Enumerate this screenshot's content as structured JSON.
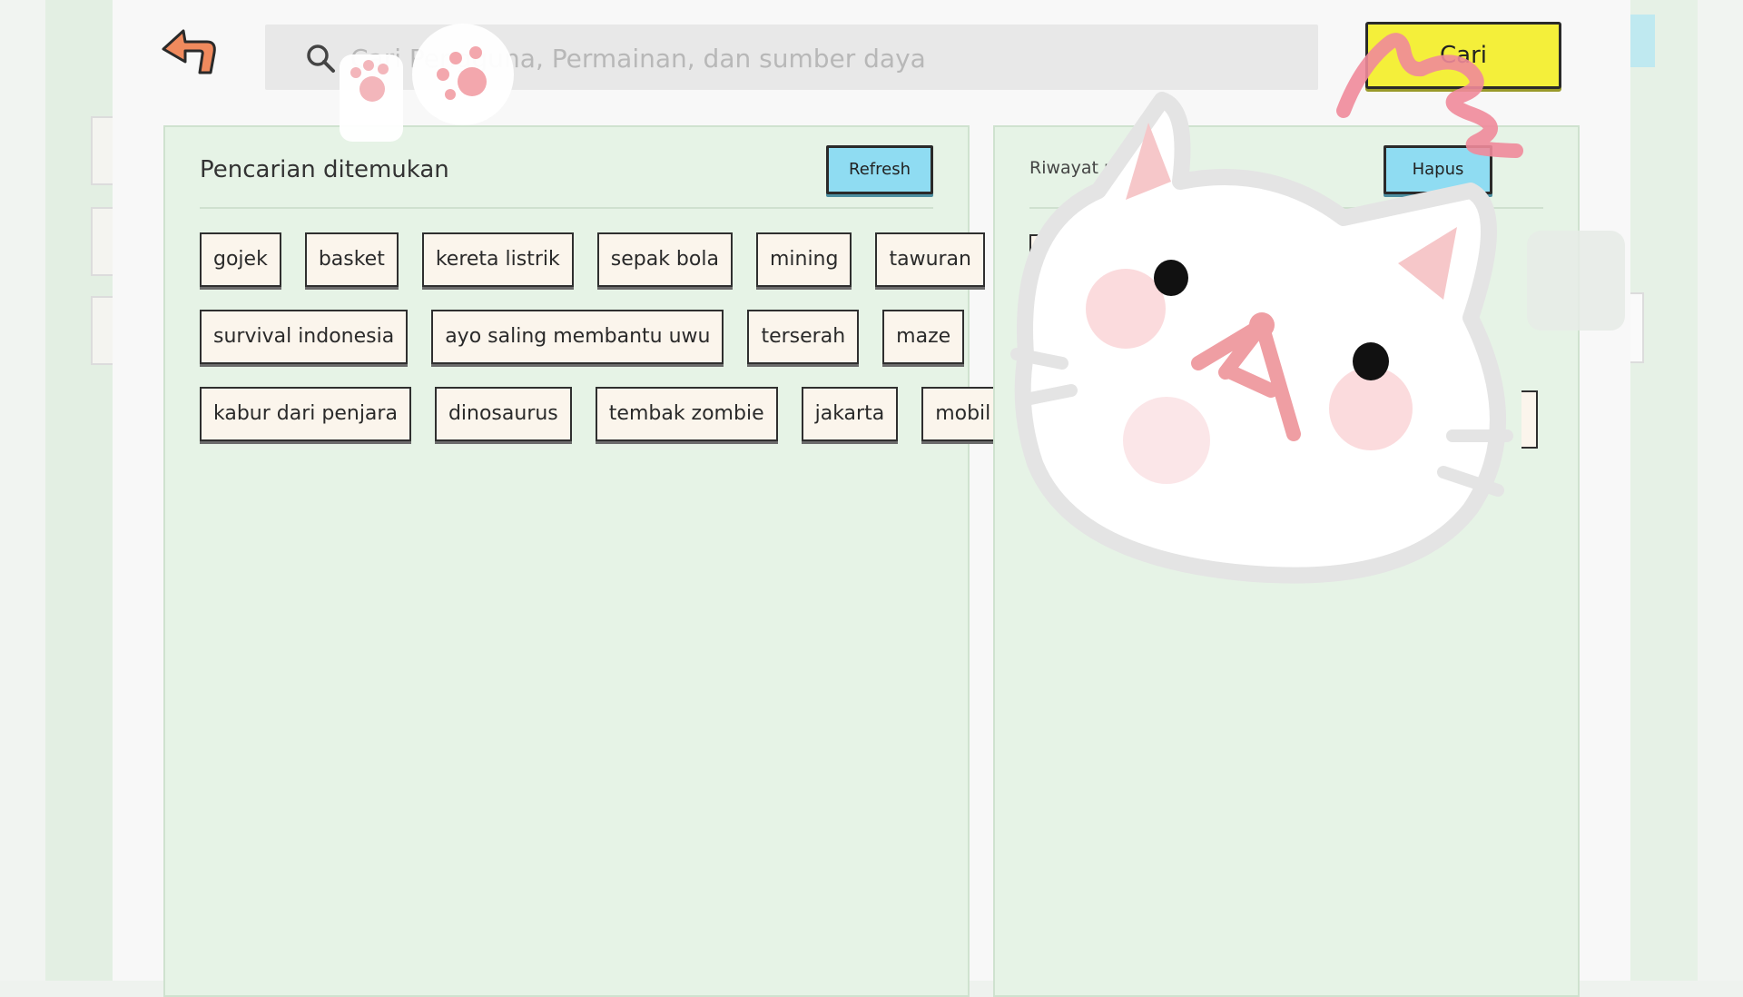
{
  "search": {
    "placeholder": "Cari Pengguna, Permainan, dan sumber daya",
    "submit_label": "Cari"
  },
  "found_panel": {
    "title": "Pencarian ditemukan",
    "refresh_label": "Refresh",
    "rows": [
      [
        "gojek",
        "basket",
        "kereta listrik",
        "sepak bola",
        "mining",
        "tawuran"
      ],
      [
        "survival indonesia",
        "ayo saling membantu uwu",
        "terserah",
        "maze"
      ],
      [
        "kabur dari penjara",
        "dinosaurus",
        "tembak zombie",
        "jakarta",
        "mobil"
      ]
    ]
  },
  "history_panel": {
    "title": "Riwayat pencari",
    "clear_label": "Hapus"
  },
  "colors": {
    "search_button": "#f4ef3a",
    "action_button": "#8fdcf2",
    "panel_background": "#e6f3e6",
    "tag_background": "#fbf5ec",
    "back_arrow": "#f08a5d"
  },
  "icons": [
    "back-arrow-icon",
    "search-icon",
    "cat-sticker",
    "paw-sticker"
  ]
}
